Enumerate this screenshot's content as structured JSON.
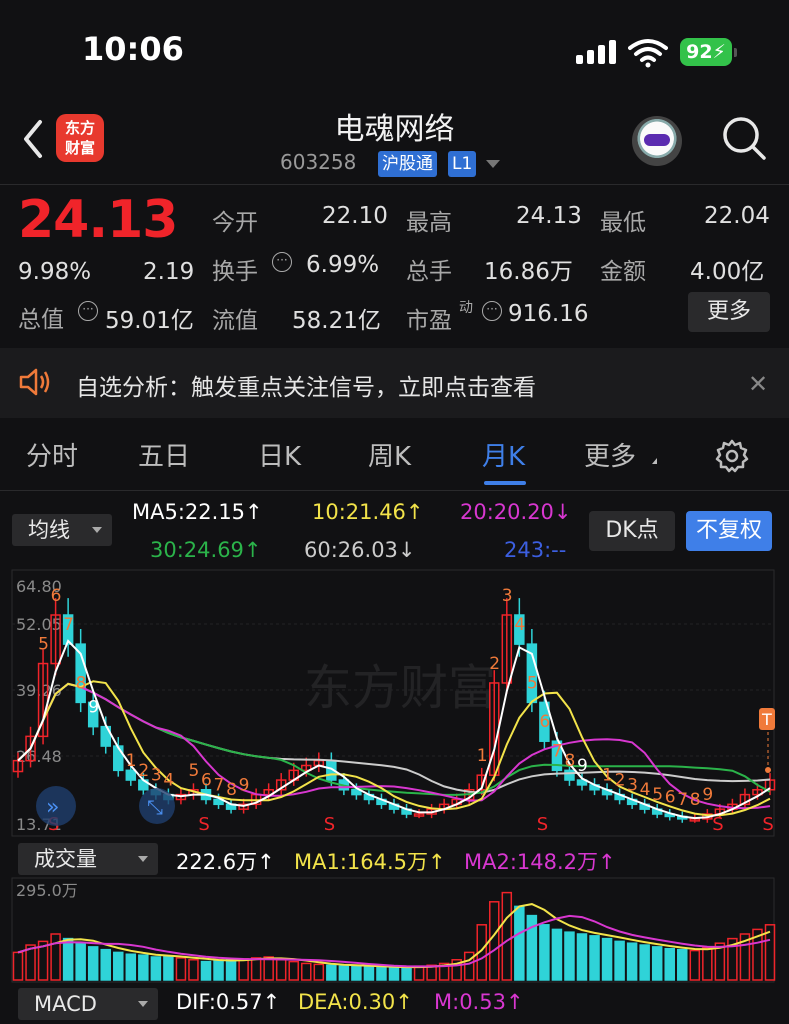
{
  "status": {
    "time": "10:06",
    "battery": "92"
  },
  "header": {
    "logo_line1": "东方",
    "logo_line2": "财富",
    "stock_name": "电魂网络",
    "stock_code": "603258",
    "tag_hgt": "沪股通",
    "tag_level": "L1"
  },
  "quote": {
    "price": "24.13",
    "change_pct": "9.98%",
    "change": "2.19",
    "open_label": "今开",
    "open": "22.10",
    "high_label": "最高",
    "high": "24.13",
    "low_label": "最低",
    "low": "22.04",
    "turnover_label": "换手",
    "turnover": "6.99%",
    "volume_label": "总手",
    "volume": "16.86万",
    "amount_label": "金额",
    "amount": "4.00亿",
    "mktcap_label": "总值",
    "mktcap": "59.01亿",
    "float_label": "流值",
    "float": "58.21亿",
    "pe_label": "市盈",
    "pe_sup": "动",
    "pe": "916.16",
    "more_label": "更多"
  },
  "banner": {
    "text": "自选分析：触发重点关注信号，立即点击查看"
  },
  "tabs": [
    {
      "label": "分时"
    },
    {
      "label": "五日"
    },
    {
      "label": "日K"
    },
    {
      "label": "周K"
    },
    {
      "label": "月K"
    },
    {
      "label": "更多"
    }
  ],
  "indicators": {
    "ma_select": "均线",
    "ma5": "MA5:22.15↑",
    "ma10": "10:21.46↑",
    "ma20": "20:20.20↓",
    "ma30": "30:24.69↑",
    "ma60": "60:26.03↓",
    "ma243": "243:--",
    "dk_label": "DK点",
    "fuquan_label": "不复权"
  },
  "kline": {
    "y_labels": [
      "64.80",
      "52.05",
      "39.26",
      "26.48",
      "13.71"
    ],
    "watermark": "东方财富",
    "marker_t": "T"
  },
  "volume": {
    "select": "成交量",
    "vol": "222.6万↑",
    "ma1": "MA1:164.5万↑",
    "ma2": "MA2:148.2万↑",
    "y_label": "295.0万"
  },
  "macd": {
    "select": "MACD",
    "dif": "DIF:0.57↑",
    "dea": "DEA:0.30↑",
    "m": "M:0.53↑"
  },
  "colors": {
    "up": "#f0242a",
    "down": "#2fd3d8",
    "ma5": "#ffffff",
    "ma10": "#f2e34a",
    "ma20": "#d837d0",
    "ma30": "#2bb34a",
    "ma60": "#cccccc",
    "ma243": "#3c5fe0",
    "accent": "#3f7fe8"
  }
}
